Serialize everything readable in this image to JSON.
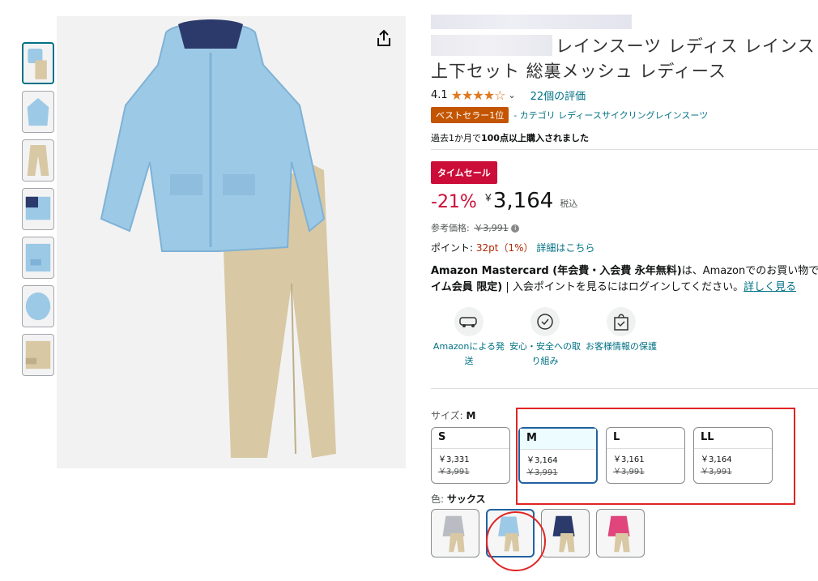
{
  "product": {
    "title_line1": "レインスーツ レディス レインス",
    "title_line2": "上下セット 総裏メッシュ レディース",
    "rating_value": "4.1",
    "rating_stars": "★★★★☆",
    "review_link": "22個の評価",
    "bestseller_badge": "ベストセラー1位",
    "bestseller_category": "- カテゴリ レディースサイクリングレインスーツ",
    "bought_prefix": "過去1か月で",
    "bought_bold": "100点以上購入されました"
  },
  "pricing": {
    "deal_badge": "タイムセール",
    "discount": "-21%",
    "currency": "￥",
    "price": "3,164",
    "tax": "税込",
    "ref_label": "参考価格:",
    "ref_price": "￥3,991",
    "points_label": "ポイント:",
    "points_value": "32pt（1%）",
    "points_link": "詳細はこちら"
  },
  "mastercard": {
    "line1_bold": "Amazon Mastercard (年会費・入会費 永年無料)",
    "line1_text": "は、Amazonでのお買い物で",
    "line2_bold": "イム会員 限定)",
    "line2_text": " | 入会ポイントを見るにはログインしてください。",
    "line2_link": "詳しく見る"
  },
  "features": [
    {
      "label": "Amazonによる発送",
      "icon": "delivery-truck-icon"
    },
    {
      "label": "安心・安全への取り組み",
      "icon": "safety-badge-icon"
    },
    {
      "label": "お客様情報の保護",
      "icon": "secure-bag-icon"
    }
  ],
  "size": {
    "label": "サイズ:",
    "selected": "M",
    "options": [
      {
        "name": "S",
        "price": "￥3,331",
        "list": "￥3,991"
      },
      {
        "name": "M",
        "price": "￥3,164",
        "list": "￥3,991"
      },
      {
        "name": "L",
        "price": "￥3,161",
        "list": "￥3,991"
      },
      {
        "name": "LL",
        "price": "￥3,164",
        "list": "￥3,991"
      }
    ]
  },
  "color": {
    "label": "色:",
    "selected": "サックス",
    "swatches": [
      "grey",
      "sax",
      "navy",
      "pink"
    ]
  },
  "colors": {
    "link": "#007185",
    "deal_red": "#cc0c39",
    "bestseller": "#c45500",
    "star": "#de7921",
    "annotation": "#e02424",
    "jacket_sax": "#9cc9e6",
    "pants_beige": "#d8c8a4"
  }
}
